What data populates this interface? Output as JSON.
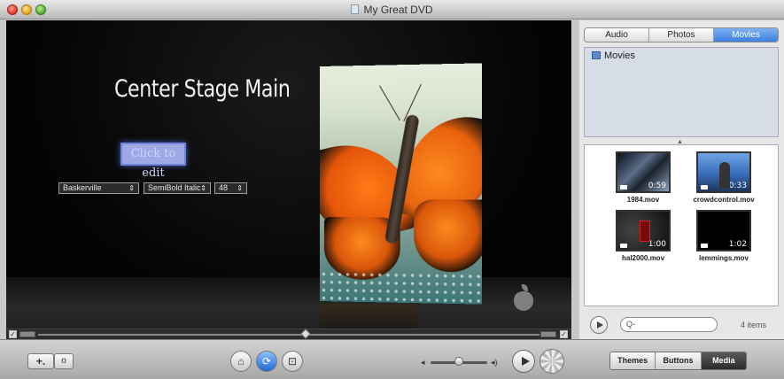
{
  "window": {
    "title": "My Great DVD"
  },
  "stage": {
    "menu_title": "Center Stage Main",
    "edit_button_label": "Click to edit",
    "font_family": "Baskerville",
    "font_style": "SemiBold Italic",
    "font_size": "48"
  },
  "media_panel": {
    "tabs": [
      {
        "label": "Audio",
        "active": false
      },
      {
        "label": "Photos",
        "active": false
      },
      {
        "label": "Movies",
        "active": true
      }
    ],
    "source_label": "Movies",
    "movies": [
      {
        "name": "1984.mov",
        "duration": "0:59"
      },
      {
        "name": "crowdcontrol.mov",
        "duration": "0:33"
      },
      {
        "name": "hal2000.mov",
        "duration": "1:00"
      },
      {
        "name": "lemmings.mov",
        "duration": "1:02"
      }
    ],
    "search_placeholder": "Q-",
    "item_count": "4 items"
  },
  "toolbar": {
    "add_label": "+.",
    "info_label": "o",
    "modes": [
      {
        "label": "Themes",
        "active": false
      },
      {
        "label": "Buttons",
        "active": false
      },
      {
        "label": "Media",
        "active": true
      }
    ]
  },
  "colors": {
    "accent": "#3d7fe0",
    "stage_background": "#000000",
    "active_mode": "#2c2c2c"
  }
}
